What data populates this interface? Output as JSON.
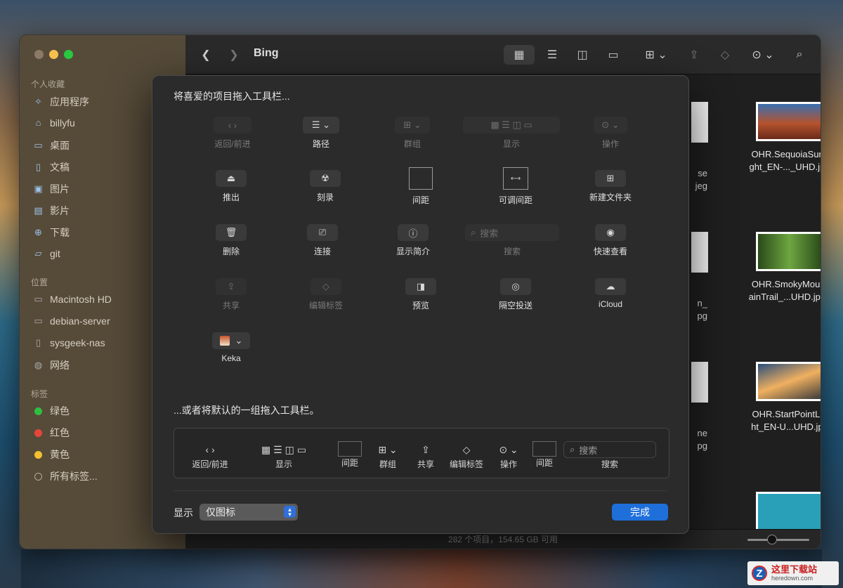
{
  "window": {
    "title": "Bing",
    "status": "282 个项目，154.65 GB 可用"
  },
  "sidebar": {
    "favorites_title": "个人收藏",
    "favorites": [
      {
        "label": "应用程序",
        "icon": "apps-icon"
      },
      {
        "label": "billyfu",
        "icon": "home-icon"
      },
      {
        "label": "桌面",
        "icon": "desktop-icon"
      },
      {
        "label": "文稿",
        "icon": "document-icon"
      },
      {
        "label": "图片",
        "icon": "photo-icon"
      },
      {
        "label": "影片",
        "icon": "film-icon"
      },
      {
        "label": "下载",
        "icon": "download-icon"
      },
      {
        "label": "git",
        "icon": "folder-icon"
      }
    ],
    "locations_title": "位置",
    "locations": [
      {
        "label": "Macintosh HD",
        "icon": "disk-icon"
      },
      {
        "label": "debian-server",
        "icon": "server-icon"
      },
      {
        "label": "sysgeek-nas",
        "icon": "document-icon"
      },
      {
        "label": "网络",
        "icon": "globe-icon"
      }
    ],
    "tags_title": "标签",
    "tags": [
      {
        "label": "绿色",
        "color": "#2fbf3f"
      },
      {
        "label": "红色",
        "color": "#e8453c"
      },
      {
        "label": "黄色",
        "color": "#f2c12e"
      },
      {
        "label": "所有标签...",
        "color": ""
      }
    ]
  },
  "files": [
    {
      "name_line1": "OHR.SequoiaSunli",
      "name_line2": "ght_EN-..._UHD.jpg",
      "thumb_color": "#b5532e"
    },
    {
      "name_line1": "OHR.SmokyMount",
      "name_line2": "ainTrail_...UHD.jpeg",
      "thumb_color": "#3d7a2a"
    },
    {
      "name_line1": "OHR.StartPointLig",
      "name_line2": "ht_EN-U...UHD.jpg",
      "thumb_color": "#2a4e7a"
    },
    {
      "name_line1": "",
      "name_line2": "",
      "thumb_color": "#2aa0b8"
    }
  ],
  "peek_labels": [
    {
      "line1": "se",
      "line2": "jeg"
    },
    {
      "line1": "n_",
      "line2": "pg"
    },
    {
      "line1": "ne",
      "line2": "pg"
    }
  ],
  "sheet": {
    "heading": "将喜爱的项目拖入工具栏...",
    "items": {
      "back_forward": "返回/前进",
      "path": "路径",
      "group": "群组",
      "view": "显示",
      "action": "操作",
      "eject": "推出",
      "burn": "刻录",
      "space": "间距",
      "flexible_space": "可调间距",
      "new_folder": "新建文件夹",
      "delete": "删除",
      "connect": "连接",
      "get_info": "显示简介",
      "search_placeholder": "搜索",
      "search": "搜索",
      "quick_look": "快速查看",
      "share": "共享",
      "edit_tags": "编辑标签",
      "preview": "预览",
      "airdrop": "隔空投送",
      "icloud": "iCloud",
      "keka": "Keka"
    },
    "default_heading": "...或者将默认的一组拖入工具栏。",
    "default_set": {
      "back_forward": "返回/前进",
      "view": "显示",
      "space1": "间距",
      "group": "群组",
      "share": "共享",
      "edit_tags": "编辑标签",
      "action": "操作",
      "space2": "间距",
      "search_placeholder": "搜索",
      "search": "搜索"
    },
    "show_label": "显示",
    "show_value": "仅图标",
    "done": "完成"
  },
  "watermark": {
    "title": "这里下载站",
    "url": "heredown.com"
  }
}
